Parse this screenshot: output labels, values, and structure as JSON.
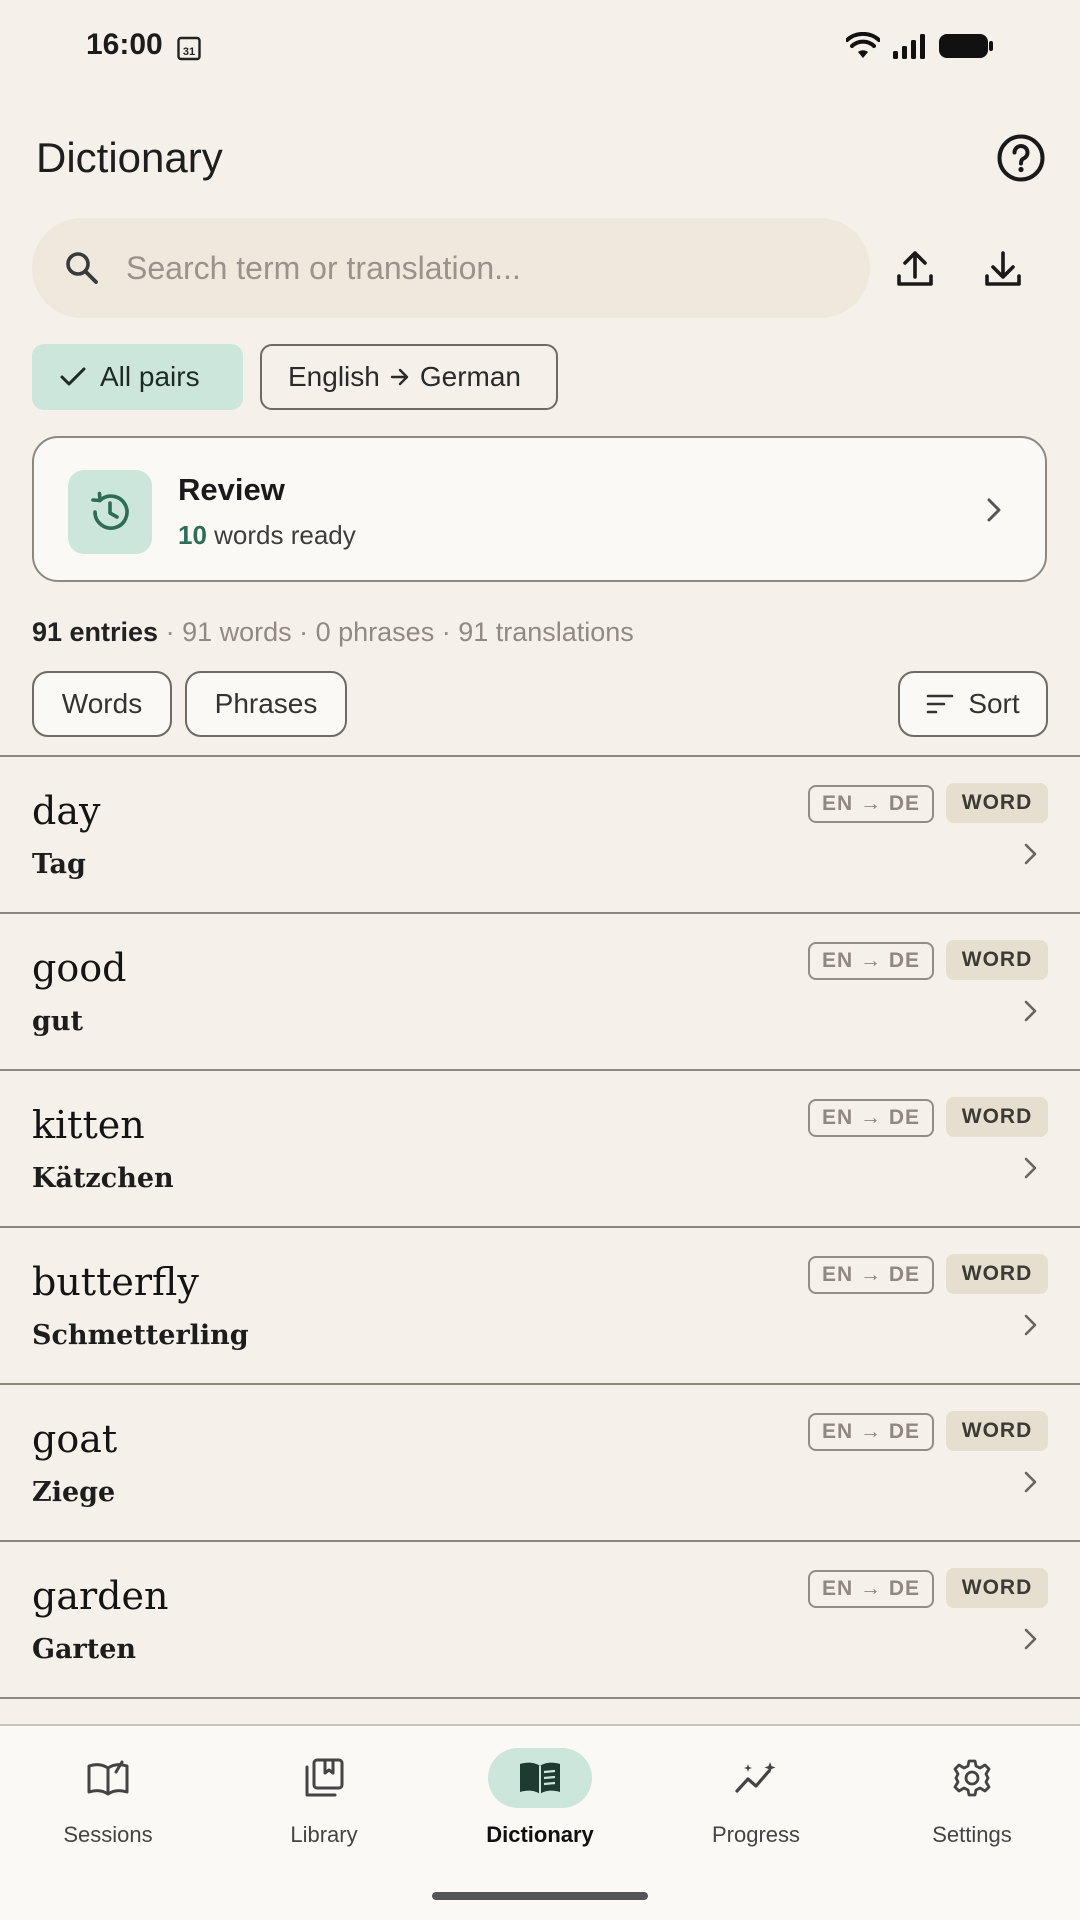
{
  "status_bar": {
    "time": "16:00",
    "calendar_day": "31"
  },
  "header": {
    "title": "Dictionary"
  },
  "search": {
    "placeholder": "Search term or translation..."
  },
  "filters": {
    "all_pairs": "All pairs",
    "pair_from": "English",
    "pair_to": "German"
  },
  "review": {
    "title": "Review",
    "count": "10",
    "suffix": " words ready"
  },
  "stats": {
    "entries": "91 entries",
    "rest": " · 91 words · 0 phrases · 91 translations"
  },
  "type_filters": {
    "words": "Words",
    "phrases": "Phrases",
    "sort": "Sort"
  },
  "entries": [
    {
      "term": "day",
      "translation": "Tag",
      "pair": "EN → DE",
      "type": "WORD"
    },
    {
      "term": "good",
      "translation": "gut",
      "pair": "EN → DE",
      "type": "WORD"
    },
    {
      "term": "kitten",
      "translation": "Kätzchen",
      "pair": "EN → DE",
      "type": "WORD"
    },
    {
      "term": "butterfly",
      "translation": "Schmetterling",
      "pair": "EN → DE",
      "type": "WORD"
    },
    {
      "term": "goat",
      "translation": "Ziege",
      "pair": "EN → DE",
      "type": "WORD"
    },
    {
      "term": "garden",
      "translation": "Garten",
      "pair": "EN → DE",
      "type": "WORD"
    }
  ],
  "nav": [
    {
      "label": "Sessions",
      "icon": "sessions-icon"
    },
    {
      "label": "Library",
      "icon": "library-icon"
    },
    {
      "label": "Dictionary",
      "icon": "dictionary-icon",
      "active": true
    },
    {
      "label": "Progress",
      "icon": "progress-icon"
    },
    {
      "label": "Settings",
      "icon": "settings-icon"
    }
  ],
  "colors": {
    "accent": "#cde6dc",
    "accent_text": "#2e6c57",
    "background": "#f5f0e9"
  }
}
